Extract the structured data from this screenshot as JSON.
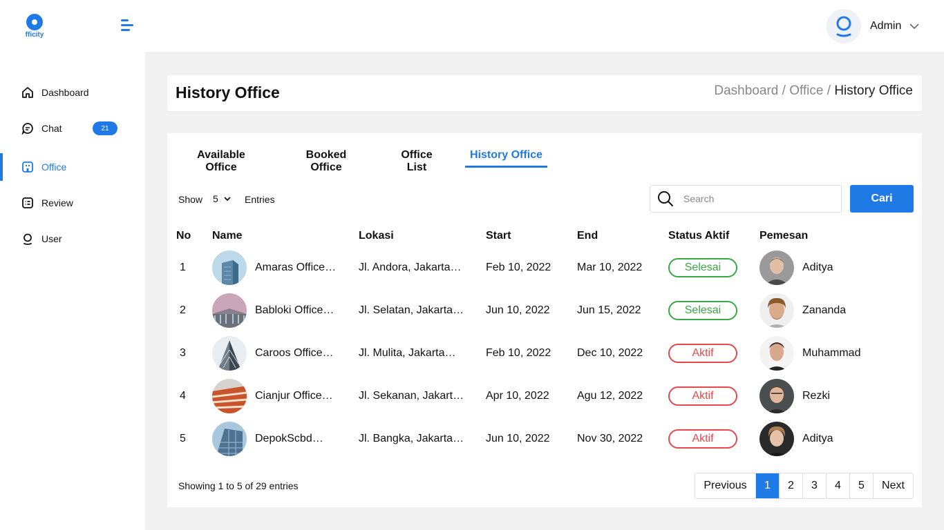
{
  "app": {
    "brand": "fficity",
    "accent": "#1f7ae6"
  },
  "header": {
    "user_name": "Admin"
  },
  "sidebar": {
    "items": [
      {
        "label": "Dashboard",
        "icon": "home-icon"
      },
      {
        "label": "Chat",
        "icon": "chat-icon",
        "badge": "21"
      },
      {
        "label": "Office",
        "icon": "office-icon",
        "active": true
      },
      {
        "label": "Review",
        "icon": "review-icon"
      },
      {
        "label": "User",
        "icon": "user-icon"
      }
    ]
  },
  "page": {
    "title": "History Office",
    "breadcrumb": [
      "Dashboard",
      "Office",
      "History Office"
    ]
  },
  "tabs": [
    "Available Office",
    "Booked Office",
    "Office List",
    "History Office"
  ],
  "active_tab": "History Office",
  "controls": {
    "show_label": "Show",
    "show_value": "5",
    "entries_label": "Entries",
    "search_placeholder": "Search",
    "search_button": "Cari"
  },
  "table": {
    "columns": [
      "No",
      "Name",
      "Lokasi",
      "Start",
      "End",
      "Status Aktif",
      "Pemesan"
    ],
    "rows": [
      {
        "no": "1",
        "name": "Amaras Office…",
        "lokasi": "Jl. Andora, Jakarta…",
        "start": "Feb 10, 2022",
        "end": "Mar 10, 2022",
        "status": "Selesai",
        "pemesan": "Aditya"
      },
      {
        "no": "2",
        "name": "Babloki Office…",
        "lokasi": "Jl. Selatan, Jakarta…",
        "start": "Jun 10, 2022",
        "end": "Jun 15, 2022",
        "status": "Selesai",
        "pemesan": "Zananda"
      },
      {
        "no": "3",
        "name": "Caroos Office…",
        "lokasi": "Jl. Mulita, Jakarta…",
        "start": "Feb 10, 2022",
        "end": "Dec 10, 2022",
        "status": "Aktif",
        "pemesan": "Muhammad"
      },
      {
        "no": "4",
        "name": "Cianjur Office…",
        "lokasi": "Jl. Sekanan, Jakart…",
        "start": "Apr 10, 2022",
        "end": "Agu 12, 2022",
        "status": "Aktif",
        "pemesan": "Rezki"
      },
      {
        "no": "5",
        "name": "DepokScbd…",
        "lokasi": "Jl. Bangka, Jakarta…",
        "start": "Jun 10, 2022",
        "end": "Nov 30, 2022",
        "status": "Aktif",
        "pemesan": "Aditya"
      }
    ]
  },
  "status_colors": {
    "Selesai": "#3aa845",
    "Aktif": "#e5484d"
  },
  "footer": {
    "showing": "Showing 1 to 5 of 29 entries",
    "previous": "Previous",
    "pages": [
      "1",
      "2",
      "3",
      "4",
      "5"
    ],
    "current_page": "1",
    "next": "Next"
  }
}
